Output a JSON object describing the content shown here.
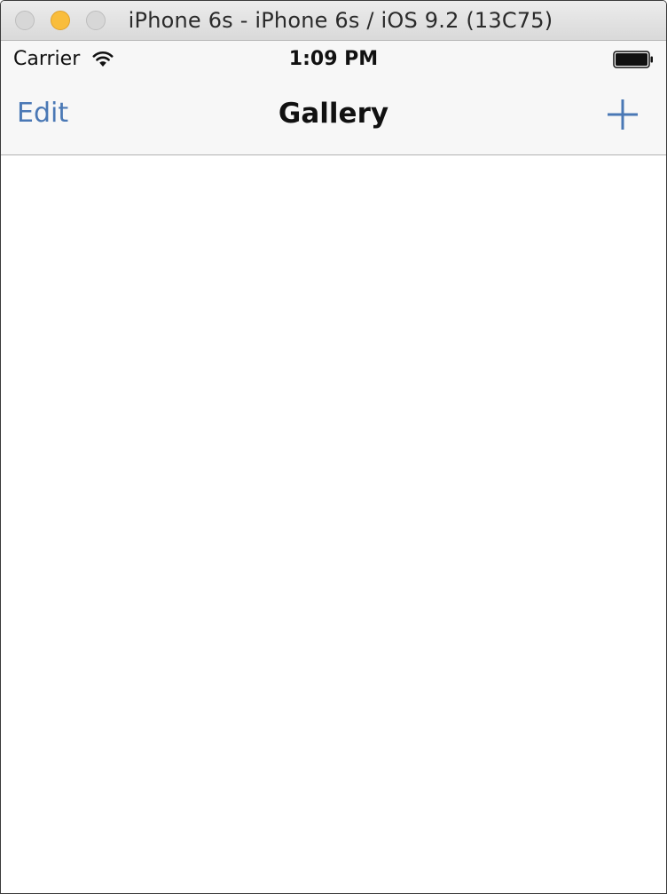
{
  "window": {
    "title": "iPhone 6s - iPhone 6s / iOS 9.2 (13C75)"
  },
  "status_bar": {
    "carrier": "Carrier",
    "time": "1:09 PM",
    "wifi_icon": "wifi-icon",
    "battery_icon": "battery-icon",
    "battery_level": 1.0
  },
  "nav_bar": {
    "left_button": "Edit",
    "title": "Gallery",
    "right_icon": "plus-icon"
  },
  "colors": {
    "tint": "#4a78b5",
    "nav_background": "#f7f7f7",
    "minimize": "#f9bd3c"
  }
}
